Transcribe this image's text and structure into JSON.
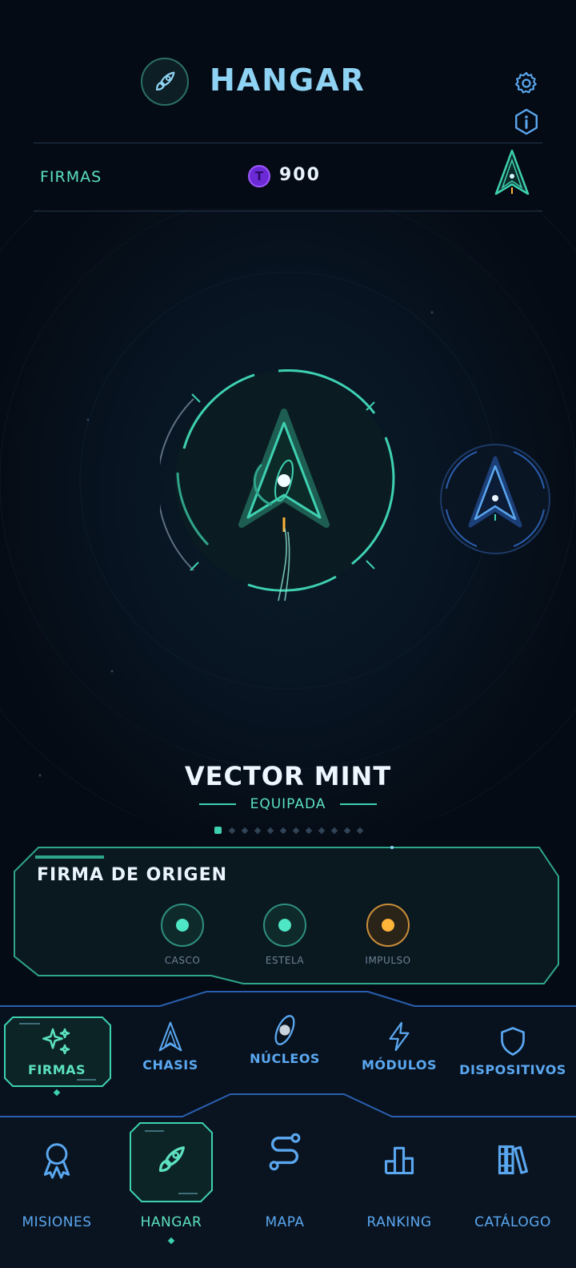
{
  "header": {
    "title": "HANGAR",
    "settings_icon": "gear-icon",
    "info_icon": "info-hex-icon",
    "logo_icon": "rocket-icon"
  },
  "currency_bar": {
    "label": "FIRMAS",
    "coin_symbol": "T",
    "amount": "900",
    "preview_icon": "ship-arrow-icon"
  },
  "ship": {
    "name": "VECTOR MINT",
    "status": "EQUIPADA",
    "carousel_total": 12,
    "carousel_active": 1
  },
  "firma_card": {
    "title": "FIRMA DE ORIGEN",
    "slots": [
      {
        "label": "CASCO",
        "color": "#4ee6c4"
      },
      {
        "label": "ESTELA",
        "color": "#4ee6c4"
      },
      {
        "label": "IMPULSO",
        "color": "#ffb43a"
      }
    ]
  },
  "categories": [
    {
      "label": "FIRMAS",
      "icon": "sparkle-icon",
      "active": true
    },
    {
      "label": "CHASIS",
      "icon": "ship-arrow-icon",
      "active": false
    },
    {
      "label": "NÚCLEOS",
      "icon": "core-orbit-icon",
      "active": false
    },
    {
      "label": "MÓDULOS",
      "icon": "lightning-icon",
      "active": false
    },
    {
      "label": "DISPOSITIVOS",
      "icon": "shield-icon",
      "active": false
    }
  ],
  "bottom_nav": [
    {
      "label": "MISIONES",
      "icon": "medal-icon",
      "active": false
    },
    {
      "label": "HANGAR",
      "icon": "rocket-icon",
      "active": true
    },
    {
      "label": "MAPA",
      "icon": "route-icon",
      "active": false
    },
    {
      "label": "RANKING",
      "icon": "bar-chart-icon",
      "active": false
    },
    {
      "label": "CATÁLOGO",
      "icon": "books-icon",
      "active": false
    }
  ],
  "colors": {
    "accent_mint": "#3ed1b1",
    "accent_blue": "#5aa7f0",
    "background": "#050b14",
    "coin": "#6b2ad6"
  }
}
